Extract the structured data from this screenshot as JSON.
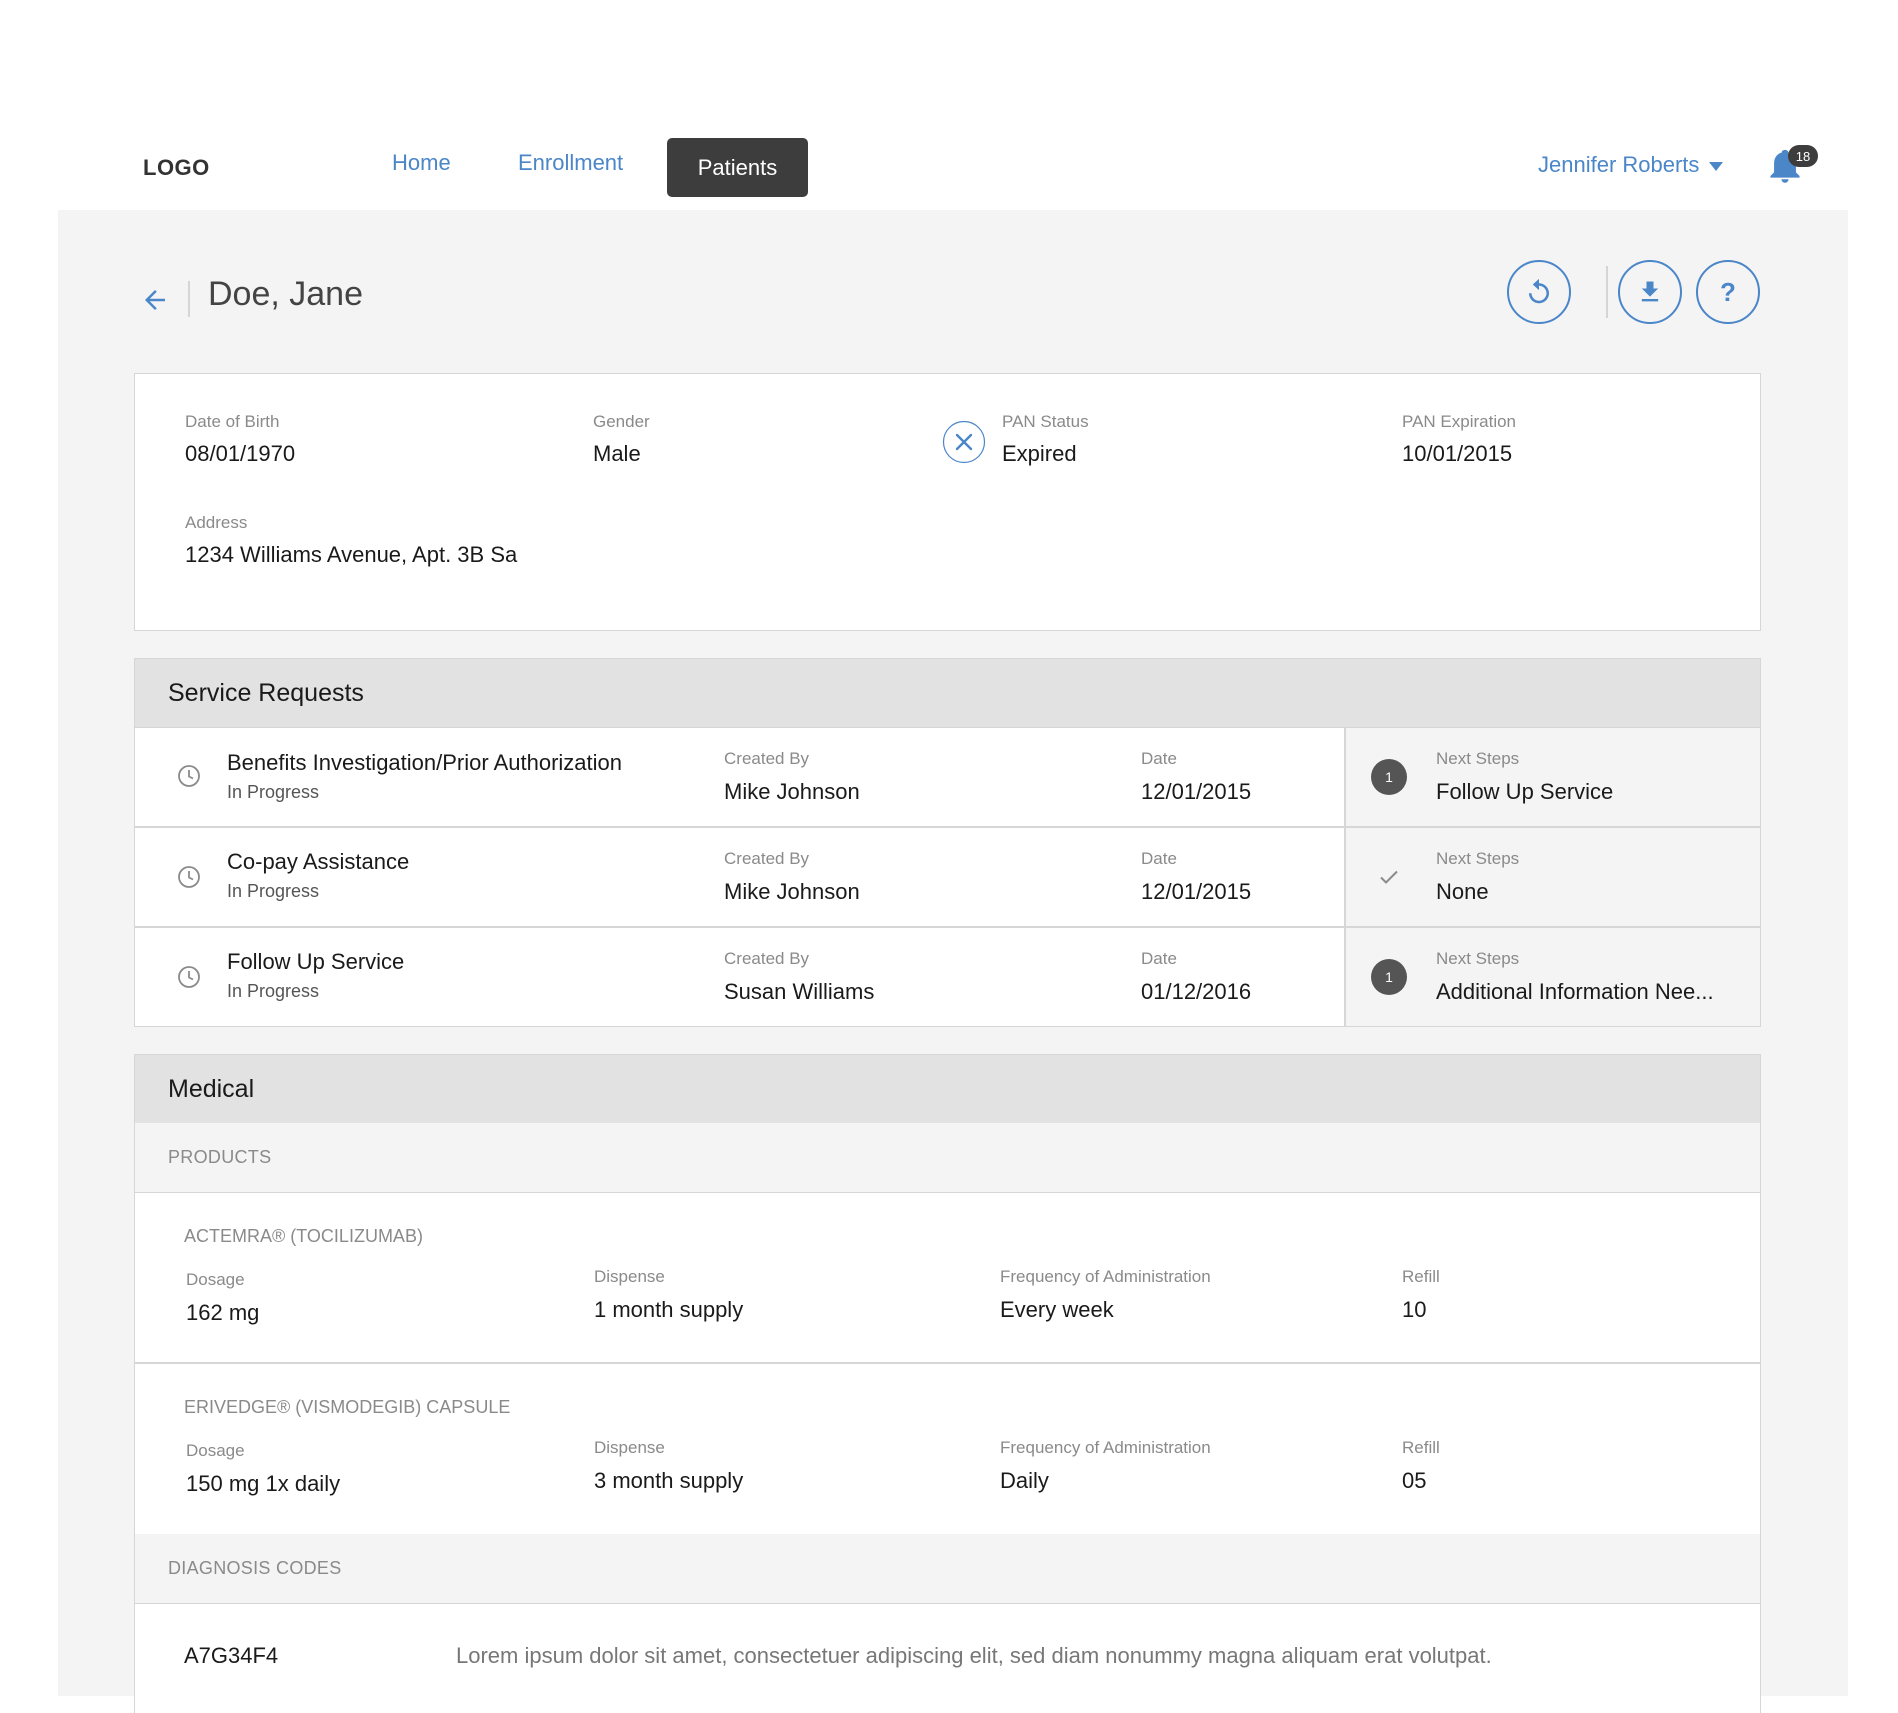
{
  "nav": {
    "logo": "LOGO",
    "links": [
      "Home",
      "Enrollment",
      "Patients"
    ],
    "active": "Patients",
    "user": "Jennifer Roberts",
    "notification_count": "18"
  },
  "patient": {
    "name": "Doe, Jane",
    "actions": [
      "refresh-icon",
      "download-icon",
      "help-icon"
    ],
    "help_label": "?",
    "fields": {
      "dob_label": "Date of Birth",
      "dob": "08/01/1970",
      "gender_label": "Gender",
      "gender": "Male",
      "pan_status_label": "PAN Status",
      "pan_status": "Expired",
      "pan_exp_label": "PAN Expiration",
      "pan_exp": "10/01/2015",
      "address_label": "Address",
      "address": "1234 Williams Avenue, Apt. 3B  Sa"
    }
  },
  "service_requests": {
    "title": "Service Requests",
    "created_by_label": "Created By",
    "date_label": "Date",
    "next_steps_label": "Next Steps",
    "rows": [
      {
        "name": "Benefits Investigation/Prior Authorization",
        "status": "In Progress",
        "created_by": "Mike Johnson",
        "date": "12/01/2015",
        "next_badge": "1",
        "next_steps": "Follow Up Service"
      },
      {
        "name": "Co-pay Assistance",
        "status": "In Progress",
        "created_by": "Mike Johnson",
        "date": "12/01/2015",
        "next_badge": "",
        "next_steps": "None"
      },
      {
        "name": "Follow Up Service",
        "status": "In Progress",
        "created_by": "Susan Williams",
        "date": "01/12/2016",
        "next_badge": "1",
        "next_steps": "Additional Information Nee..."
      }
    ]
  },
  "medical": {
    "title": "Medical",
    "products_label": "PRODUCTS",
    "dosage_label": "Dosage",
    "dispense_label": "Dispense",
    "frequency_label": "Frequency of Administration",
    "refill_label": "Refill",
    "products": [
      {
        "name": "ACTEMRA® (TOCILIZUMAB)",
        "dosage": "162 mg",
        "dispense": "1 month supply",
        "frequency": "Every week",
        "refill": "10"
      },
      {
        "name": "ERIVEDGE® (VISMODEGIB) CAPSULE",
        "dosage": "150 mg 1x daily",
        "dispense": "3 month supply",
        "frequency": "Daily",
        "refill": "05"
      }
    ],
    "diagnosis_label": "DIAGNOSIS CODES",
    "diagnosis": [
      {
        "code": "A7G34F4",
        "description": "Lorem ipsum dolor sit amet, consectetuer adipiscing elit, sed diam nonummy magna aliquam erat volutpat."
      }
    ]
  },
  "colors": {
    "accent": "#4a86c8",
    "active_nav": "#3d3d3d",
    "page_bg": "#f4f4f5"
  }
}
